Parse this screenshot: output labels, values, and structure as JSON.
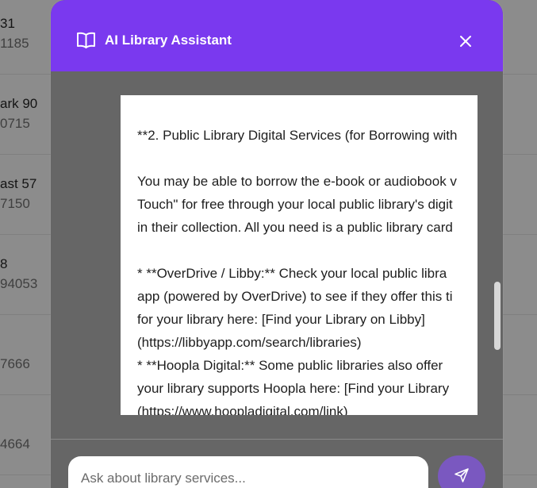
{
  "background_list": [
    {
      "title": "31",
      "sub": "1185"
    },
    {
      "title": "ark 90",
      "sub": "0715"
    },
    {
      "title": "ast 57",
      "sub": "7150"
    },
    {
      "title": "8",
      "sub": "94053"
    },
    {
      "title": "",
      "sub": "7666"
    },
    {
      "title": "",
      "sub": "4664"
    }
  ],
  "modal": {
    "title": "AI Library Assistant",
    "header_icon": "book-open-icon",
    "close_icon": "close-icon",
    "accent_color": "#7a39ef"
  },
  "message": {
    "lines": [
      "**2. Public Library Digital Services (for Borrowing with",
      "",
      "You may be able to borrow the e-book or audiobook v",
      "Touch\" for free through your local public library's digit",
      "in their collection. All you need is a public library card",
      "",
      "*   **OverDrive / Libby:** Check your local public libra",
      "app (powered by OverDrive) to see if they offer this ti",
      "for your library here: [Find your Library on Libby]",
      "(https://libbyapp.com/search/libraries)",
      "*   **Hoopla Digital:** Some public libraries also offer",
      "your library supports Hoopla here: [Find your Library",
      "(https://www.hoopladigital.com/link)"
    ]
  },
  "input": {
    "placeholder": "Ask about library services...",
    "send_icon": "send-icon"
  }
}
